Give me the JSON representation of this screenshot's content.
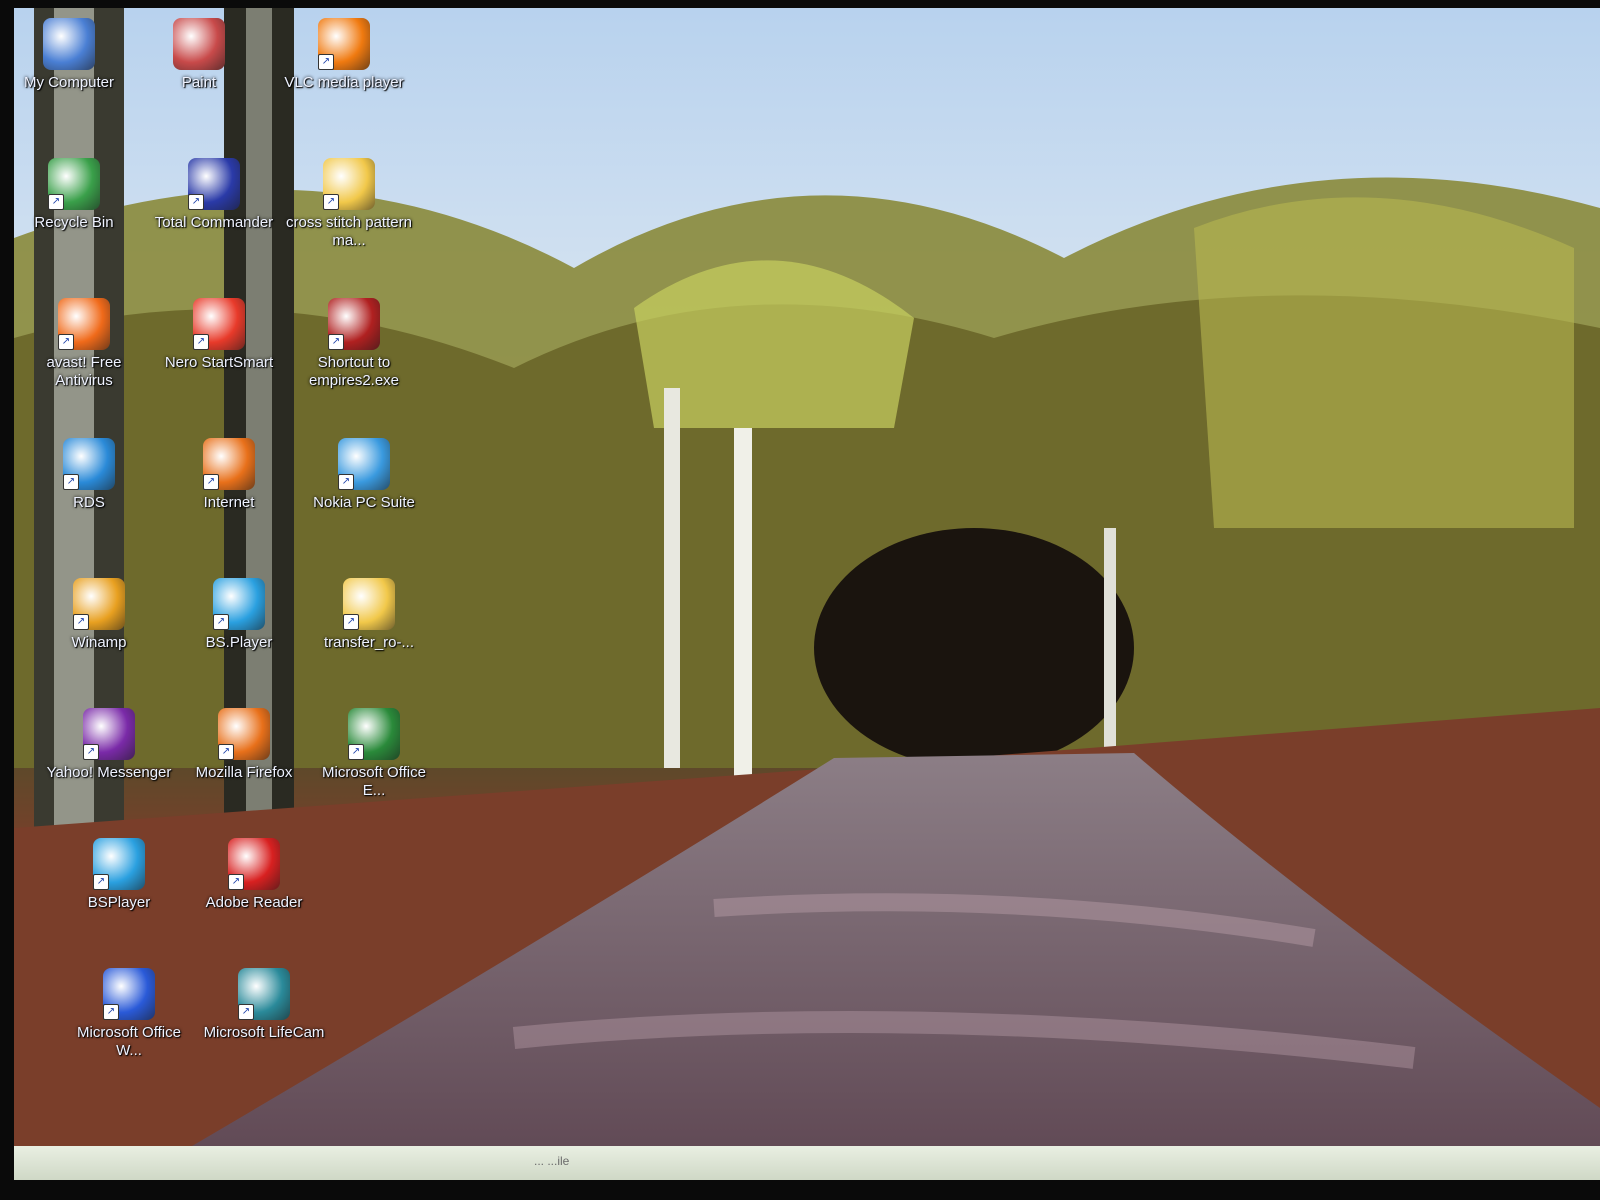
{
  "desktop": {
    "icons": [
      {
        "label": "My Computer",
        "icon": "computer-icon",
        "color": "#4a7fd4"
      },
      {
        "label": "Paint",
        "icon": "paint-icon",
        "color": "#c84a4a"
      },
      {
        "label": "VLC media player",
        "icon": "vlc-cone-icon",
        "color": "#f07a10"
      },
      {
        "label": "Recycle Bin",
        "icon": "recycle-bin-icon",
        "color": "#3aa04a"
      },
      {
        "label": "Total Commander",
        "icon": "floppy-disk-icon",
        "color": "#2a3aa8"
      },
      {
        "label": "cross stitch pattern ma...",
        "icon": "folder-icon",
        "color": "#f1c84a"
      },
      {
        "label": "avast! Free Antivirus",
        "icon": "avast-icon",
        "color": "#f06a1a"
      },
      {
        "label": "Nero StartSmart",
        "icon": "nero-icon",
        "color": "#e83a2a"
      },
      {
        "label": "Shortcut to empires2.exe",
        "icon": "helmet-icon",
        "color": "#b02020"
      },
      {
        "label": "RDS",
        "icon": "globe-icon",
        "color": "#2a8ad8"
      },
      {
        "label": "Internet",
        "icon": "firefox-icon",
        "color": "#e8701a"
      },
      {
        "label": "Nokia PC Suite",
        "icon": "nokia-icon",
        "color": "#3a9adf"
      },
      {
        "label": "Winamp",
        "icon": "winamp-icon",
        "color": "#e8a020"
      },
      {
        "label": "BS.Player",
        "icon": "bsplayer-icon",
        "color": "#2aa0e0"
      },
      {
        "label": "transfer_ro-...",
        "icon": "folder-icon",
        "color": "#f1c84a"
      },
      {
        "label": "Yahoo! Messenger",
        "icon": "yahoo-icon",
        "color": "#7a2aa8"
      },
      {
        "label": "Mozilla Firefox",
        "icon": "firefox-icon",
        "color": "#e8701a"
      },
      {
        "label": "Microsoft Office E...",
        "icon": "excel-icon",
        "color": "#2a8a3a"
      },
      {
        "label": "BSPlayer",
        "icon": "bsplayer-icon",
        "color": "#2aa0e0"
      },
      {
        "label": "Adobe Reader",
        "icon": "adobe-reader-icon",
        "color": "#d82020"
      },
      {
        "label": "Microsoft Office W...",
        "icon": "word-icon",
        "color": "#2a5ad8"
      },
      {
        "label": "Microsoft LifeCam",
        "icon": "webcam-icon",
        "color": "#2a8a9a"
      }
    ]
  },
  "taskbar": {
    "text": "... ...ile"
  }
}
